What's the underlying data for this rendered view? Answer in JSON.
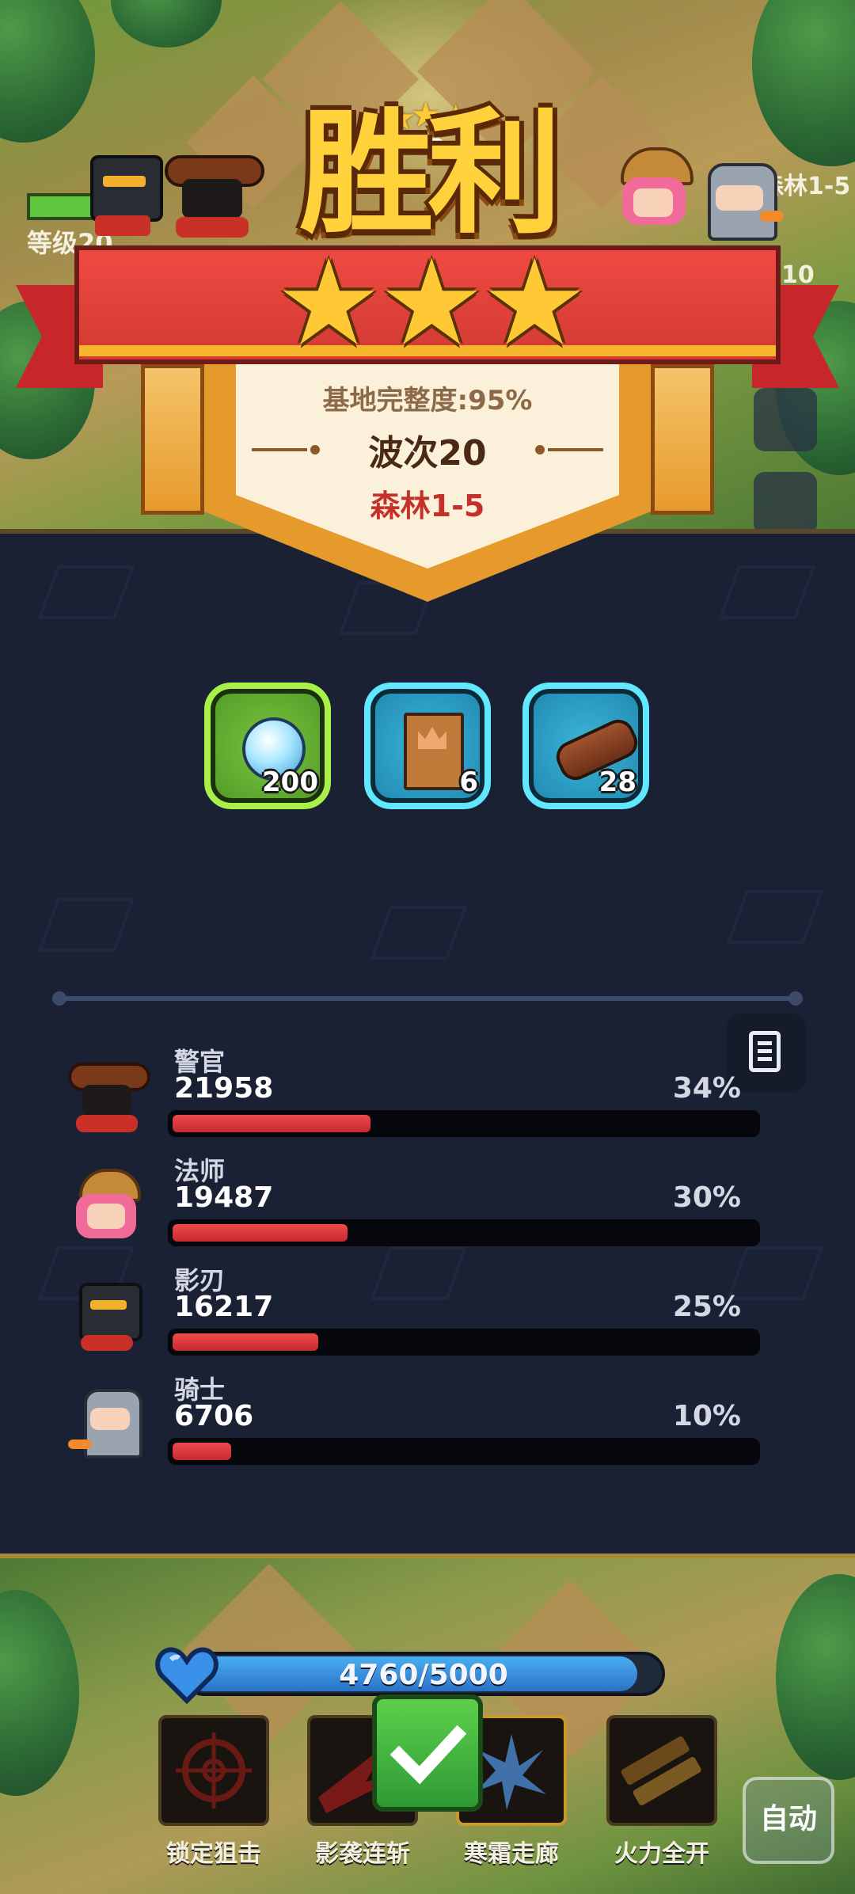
{
  "victory": {
    "title": "胜利",
    "stars_earned": 3,
    "stars_total": 3,
    "base_integrity": "基地完整度:95%",
    "wave": "波次20",
    "stage": "森林1-5"
  },
  "background_hud": {
    "level_label": "等级20",
    "stage_label": "森林1-5",
    "timer_partial": ":10",
    "wave_partial": "2"
  },
  "rewards": [
    {
      "icon": "crystal-orb-icon",
      "count": "200",
      "frame_color": "#a9f04a"
    },
    {
      "icon": "crown-book-icon",
      "count": "6",
      "frame_color": "#61e8ff"
    },
    {
      "icon": "wood-log-icon",
      "count": "28",
      "frame_color": "#61e8ff"
    }
  ],
  "damage_stats": [
    {
      "hero": "警官",
      "damage": "21958",
      "percent": "34%",
      "share": 0.34
    },
    {
      "hero": "法师",
      "damage": "19487",
      "percent": "30%",
      "share": 0.3
    },
    {
      "hero": "影刃",
      "damage": "16217",
      "percent": "25%",
      "share": 0.25
    },
    {
      "hero": "骑士",
      "damage": "6706",
      "percent": "10%",
      "share": 0.1
    }
  ],
  "base_hp": {
    "text": "4760/5000",
    "current": 4760,
    "max": 5000
  },
  "skills": [
    {
      "label": "锁定狙击",
      "icon": "crosshair-icon"
    },
    {
      "label": "影袭连斩",
      "icon": "shadow-slash-icon"
    },
    {
      "label": "寒霜走廊",
      "icon": "frost-icon"
    },
    {
      "label": "火力全开",
      "icon": "twin-guns-icon"
    }
  ],
  "auto_button": "自动",
  "colors": {
    "panel_bg": "#1b2135",
    "ribbon_red": "#e8443c",
    "gold": "#ffd23c",
    "damage_bar": "#e03a3c",
    "hp_bar": "#3a90e0",
    "stage_text": "#c4302a"
  }
}
